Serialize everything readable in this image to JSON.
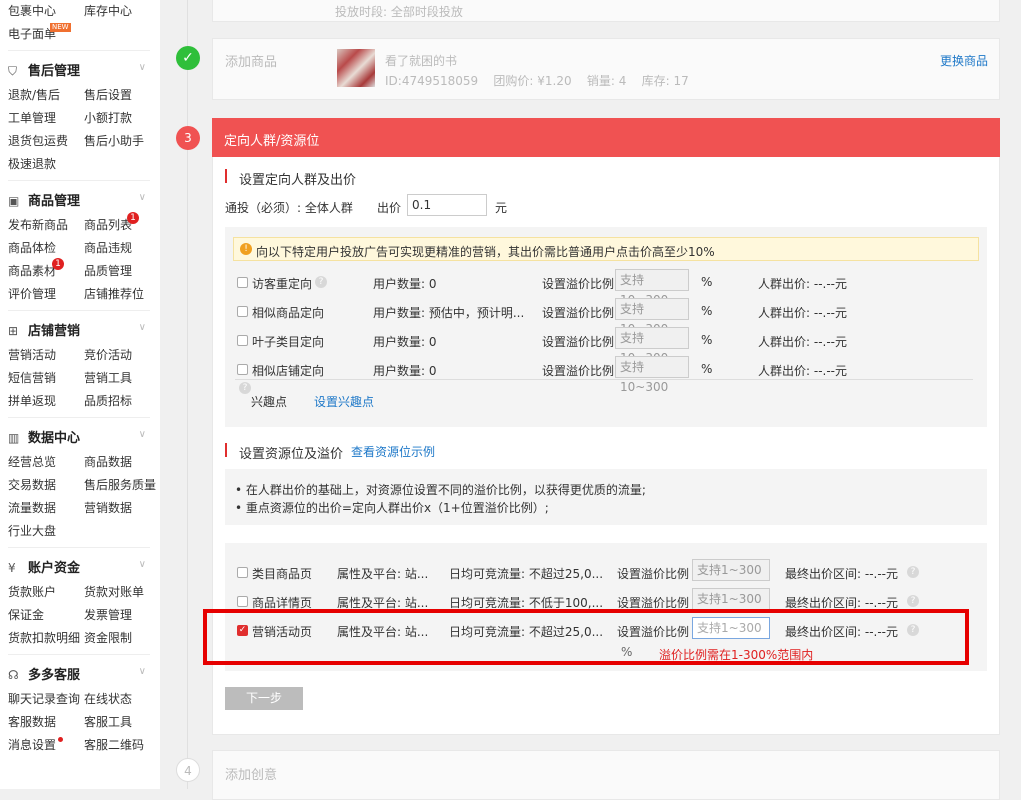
{
  "sidebar": {
    "top_rows": [
      {
        "c1": "包裹中心",
        "c2": "库存中心"
      },
      {
        "c1": "电子面单",
        "tag": "NEW"
      }
    ],
    "groups": [
      {
        "title": "售后管理",
        "icon": "shield-icon",
        "rows": [
          {
            "c1": "退款/售后",
            "c2": "售后设置"
          },
          {
            "c1": "工单管理",
            "c2": "小额打款"
          },
          {
            "c1": "退货包运费",
            "c2": "售后小助手"
          },
          {
            "c1": "极速退款"
          }
        ]
      },
      {
        "title": "商品管理",
        "icon": "package-icon",
        "rows": [
          {
            "c1": "发布新商品",
            "c2": "商品列表",
            "badge": "1"
          },
          {
            "c1": "商品体检",
            "c2": "商品违规"
          },
          {
            "c1": "商品素材",
            "badge1": "1",
            "c2": "品质管理"
          },
          {
            "c1": "评价管理",
            "c2": "店铺推荐位"
          }
        ]
      },
      {
        "title": "店铺营销",
        "icon": "gift-icon",
        "rows": [
          {
            "c1": "营销活动",
            "c2": "竞价活动"
          },
          {
            "c1": "短信营销",
            "c2": "营销工具"
          },
          {
            "c1": "拼单返现",
            "c2": "品质招标"
          }
        ]
      },
      {
        "title": "数据中心",
        "icon": "bar-chart-icon",
        "rows": [
          {
            "c1": "经营总览",
            "c2": "商品数据"
          },
          {
            "c1": "交易数据",
            "c2": "售后服务质量"
          },
          {
            "c1": "流量数据",
            "c2": "营销数据"
          },
          {
            "c1": "行业大盘"
          }
        ]
      },
      {
        "title": "账户资金",
        "icon": "yen-icon",
        "rows": [
          {
            "c1": "货款账户",
            "c2": "货款对账单"
          },
          {
            "c1": "保证金",
            "c2": "发票管理"
          },
          {
            "c1": "货款扣款明细",
            "c2": "资金限制"
          }
        ]
      },
      {
        "title": "多多客服",
        "icon": "headset-icon",
        "rows": [
          {
            "c1": "聊天记录查询",
            "c2": "在线状态"
          },
          {
            "c1": "客服数据",
            "c2": "客服工具"
          },
          {
            "c1": "消息设置",
            "c2": "客服二维码"
          }
        ]
      }
    ]
  },
  "top_card": {
    "text": "投放时段: 全部时段投放"
  },
  "step2": {
    "label": "添加商品",
    "product_name": "看了就困的书",
    "product_meta": "ID:4749518059    团购价: ¥1.20    销量: 4    库存: 17",
    "change_link": "更换商品"
  },
  "step3": {
    "number": "3",
    "title": "定向人群/资源位",
    "section1_title": "设置定向人群及出价",
    "bid_label": "通投（必须）: 全体人群",
    "bid_price_label": "出价",
    "bid_value": "0.1",
    "bid_unit": "元",
    "notice": "向以下特定用户投放广告可实现更精准的营销，其出价需比普通用户点击价高至少10%",
    "targets": [
      {
        "name": "访客重定向",
        "users": "用户数量: 0",
        "ratio_label": "设置溢价比例",
        "placeholder": "支持10~300",
        "pct": "%",
        "price": "人群出价: --.--元",
        "help": true
      },
      {
        "name": "相似商品定向",
        "users": "用户数量: 预估中，预计明...",
        "ratio_label": "设置溢价比例",
        "placeholder": "支持10~300",
        "pct": "%",
        "price": "人群出价: --.--元"
      },
      {
        "name": "叶子类目定向",
        "users": "用户数量: 0",
        "ratio_label": "设置溢价比例",
        "placeholder": "支持10~300",
        "pct": "%",
        "price": "人群出价: --.--元"
      },
      {
        "name": "相似店铺定向",
        "users": "用户数量: 0",
        "ratio_label": "设置溢价比例",
        "placeholder": "支持10~300",
        "pct": "%",
        "price": "人群出价: --.--元"
      }
    ],
    "interest_label": "兴趣点",
    "interest_link": "设置兴趣点",
    "section2_title": "设置资源位及溢价",
    "section2_link": "查看资源位示例",
    "tips": [
      "在人群出价的基础上，对资源位设置不同的溢价比例，以获得更优质的流量;",
      "重点资源位的出价=定向人群出价x（1+位置溢价比例）;"
    ],
    "resources": [
      {
        "name": "类目商品页",
        "attr": "属性及平台: 站...",
        "traffic": "日均可竞流量: 不超过25,0...",
        "ratio_label": "设置溢价比例",
        "placeholder": "支持1~300",
        "price": "最终出价区间: --.--元",
        "checked": false
      },
      {
        "name": "商品详情页",
        "attr": "属性及平台: 站...",
        "traffic": "日均可竞流量: 不低于100,...",
        "ratio_label": "设置溢价比例",
        "placeholder": "支持1~300",
        "price": "最终出价区间: --.--元",
        "checked": false
      },
      {
        "name": "营销活动页",
        "attr": "属性及平台: 站...",
        "traffic": "日均可竞流量: 不超过25,0...",
        "ratio_label": "设置溢价比例",
        "placeholder": "支持1~300",
        "price": "最终出价区间: --.--元",
        "checked": true
      }
    ],
    "pct_symbol": "%",
    "error_msg": "溢价比例需在1-300%范围内",
    "next_button": "下一步"
  },
  "step4": {
    "number": "4",
    "label": "添加创意"
  },
  "colors": {
    "accent": "#f05252",
    "error": "#e02020",
    "link": "#1e78c8",
    "success": "#2fbf3a"
  }
}
